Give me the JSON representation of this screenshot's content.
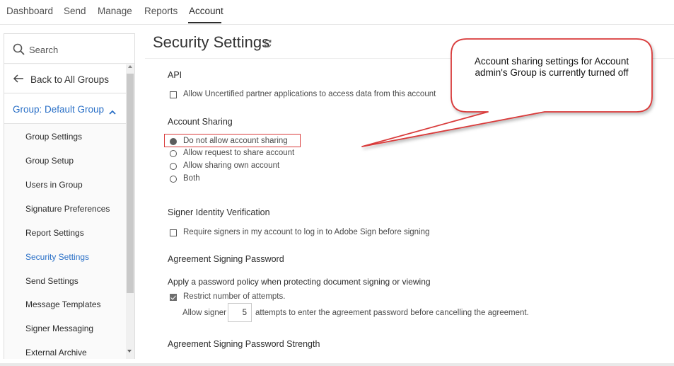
{
  "nav": {
    "tabs": [
      {
        "label": "Dashboard"
      },
      {
        "label": "Send"
      },
      {
        "label": "Manage"
      },
      {
        "label": "Reports"
      },
      {
        "label": "Account",
        "active": true
      }
    ]
  },
  "sidebar": {
    "search_label": "Search",
    "back_label": "Back to All Groups",
    "group_label": "Group: Default Group",
    "items": [
      {
        "label": "Group Settings"
      },
      {
        "label": "Group Setup"
      },
      {
        "label": "Users in Group"
      },
      {
        "label": "Signature Preferences"
      },
      {
        "label": "Report Settings"
      },
      {
        "label": "Security Settings",
        "active": true
      },
      {
        "label": "Send Settings"
      },
      {
        "label": "Message Templates"
      },
      {
        "label": "Signer Messaging"
      },
      {
        "label": "External Archive"
      }
    ]
  },
  "main": {
    "title": "Security Settings",
    "api": {
      "heading": "API",
      "option": "Allow Uncertified partner applications to access data from this account"
    },
    "account_sharing": {
      "heading": "Account Sharing",
      "options": [
        {
          "label": "Do not allow account sharing",
          "selected": true
        },
        {
          "label": "Allow request to share account"
        },
        {
          "label": "Allow sharing own account"
        },
        {
          "label": "Both"
        }
      ]
    },
    "signer_identity": {
      "heading": "Signer Identity Verification",
      "option": "Require signers in my account to log in to Adobe Sign before signing"
    },
    "agreement_password": {
      "heading": "Agreement Signing Password",
      "subheading": "Apply a password policy when protecting document signing or viewing",
      "restrict_label": "Restrict number of attempts.",
      "attempts_prefix": "Allow signer",
      "attempts_value": "5",
      "attempts_suffix": "attempts to enter the agreement password before cancelling the agreement."
    },
    "password_strength": {
      "heading": "Agreement Signing Password Strength"
    }
  },
  "callout": {
    "text": "Account sharing settings for Account admin's Group is currently turned off",
    "border_color": "#d93b3b"
  },
  "colors": {
    "link_blue": "#2a70c7",
    "highlight_red": "#d93b3b"
  }
}
